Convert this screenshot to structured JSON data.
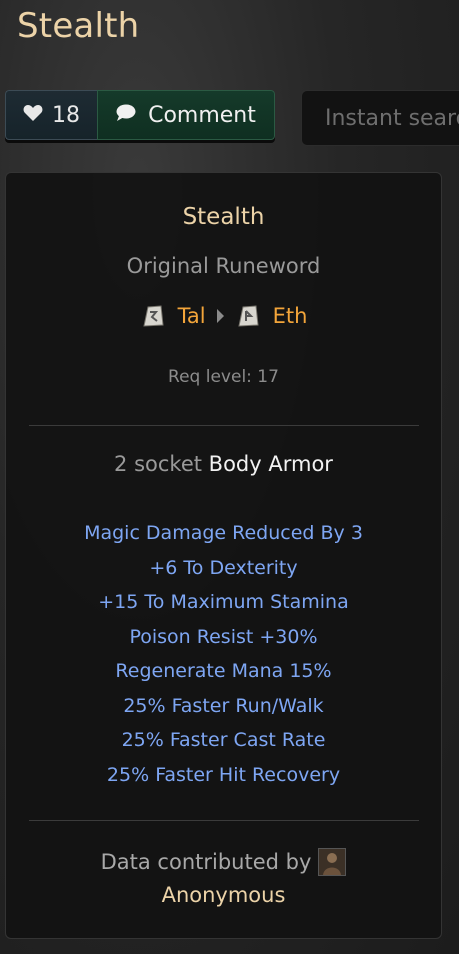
{
  "page": {
    "title": "Stealth"
  },
  "actions": {
    "like_count": "18",
    "comment_label": "Comment",
    "search_placeholder": "Instant search"
  },
  "runeword": {
    "name": "Stealth",
    "subtitle": "Original Runeword",
    "runes": [
      {
        "name": "Tal"
      },
      {
        "name": "Eth"
      }
    ],
    "req_level": "Req level: 17",
    "sockets": "2 socket",
    "base_type": "Body Armor",
    "stats": [
      "Magic Damage Reduced By 3",
      "+6 To Dexterity",
      "+15 To Maximum Stamina",
      "Poison Resist +30%",
      "Regenerate Mana 15%",
      "25% Faster Run/Walk",
      "25% Faster Cast Rate",
      "25% Faster Hit Recovery"
    ]
  },
  "contribution": {
    "label": "Data contributed by",
    "contributor": "Anonymous"
  },
  "colors": {
    "title": "#ecd3a8",
    "rune": "#f3a53a",
    "stat": "#7ea6f3",
    "comment_button": "#153a2a",
    "like_button": "#1e2b33"
  },
  "icons": {
    "like": "heart-icon",
    "comment": "speech-bubble-icon",
    "rune": "rune-stone-icon",
    "separator": "caret-right-icon"
  }
}
